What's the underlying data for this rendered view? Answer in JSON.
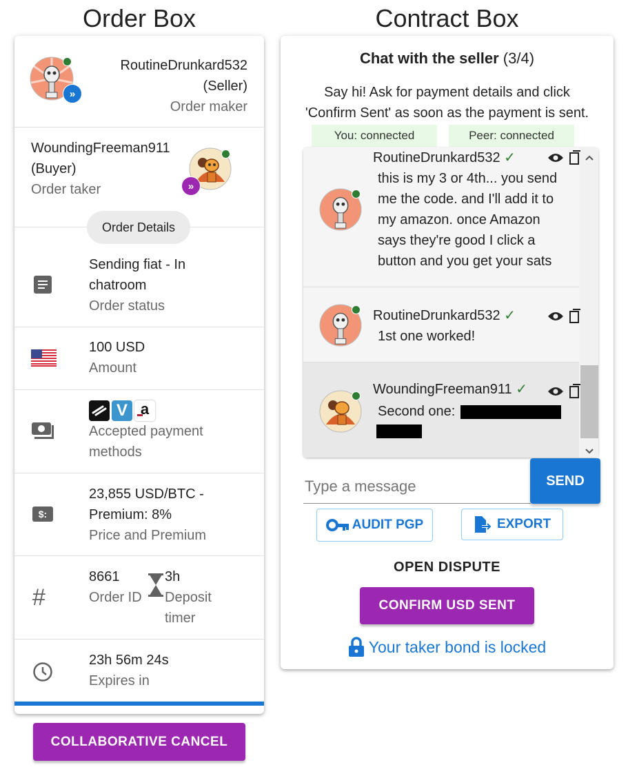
{
  "titles": {
    "order_box": "Order Box",
    "contract_box": "Contract Box"
  },
  "colors": {
    "purple": "#9c27b0",
    "blue": "#1976d2",
    "online": "#2e7d32",
    "chip_bg": "#e8f9e6"
  },
  "order": {
    "maker": {
      "name": "RoutineDrunkard532",
      "role": "(Seller)",
      "caption": "Order maker",
      "icon": "robot-avatar"
    },
    "taker": {
      "name": "WoundingFreeman911",
      "role": "(Buyer)",
      "caption": "Order taker",
      "icon": "robot-avatar"
    },
    "details_chip": "Order Details",
    "status": {
      "line1": "Sending fiat - In",
      "line2": "chatroom",
      "caption": "Order status",
      "icon": "article-icon"
    },
    "amount": {
      "value": "100 USD",
      "caption": "Amount",
      "icon": "us-flag-icon"
    },
    "payment": {
      "caption_line1": "Accepted payment",
      "caption_line2": "methods",
      "icons": [
        "strike-icon",
        "venmo-icon",
        "amazon-icon"
      ],
      "venmo_letter": "V",
      "amazon_letter": "a"
    },
    "price": {
      "line1": "23,855 USD/BTC -",
      "line2": "Premium: 8%",
      "caption": "Price and Premium",
      "icon": "price-icon",
      "icon_text": "$:"
    },
    "order_id": {
      "value": "8661",
      "caption": "Order ID",
      "icon": "hash-icon",
      "icon_text": "#"
    },
    "deposit": {
      "value": "3h",
      "caption_line1": "Deposit",
      "caption_line2": "timer",
      "icon": "hourglass-icon"
    },
    "expires": {
      "value": "23h 56m 24s",
      "caption": "Expires in",
      "icon": "clock-icon"
    },
    "collab_cancel": "COLLABORATIVE CANCEL"
  },
  "contract": {
    "chat_title": "Chat with the seller",
    "chat_count": "(3/4)",
    "intro_line1": "Say hi! Ask for payment details and click",
    "intro_line2": "'Confirm Sent' as soon as the payment is sent.",
    "you_status": "You: connected",
    "peer_status": "Peer: connected",
    "messages": [
      {
        "author": "RoutineDrunkard532",
        "lines": [
          "this is my 3 or 4th... you send",
          "me the code. and I'll add it to",
          "my amazon. once Amazon",
          "says they're good I click a",
          "button and you get your sats"
        ]
      },
      {
        "author": "RoutineDrunkard532",
        "lines": [
          "1st one worked!"
        ]
      },
      {
        "author": "WoundingFreeman911",
        "lines": [
          "Second one:"
        ]
      }
    ],
    "check_mark": "✓",
    "input_placeholder": "Type a message",
    "send": "SEND",
    "audit_pgp": "AUDIT PGP",
    "export": "EXPORT",
    "open_dispute": "OPEN DISPUTE",
    "confirm_sent": "CONFIRM USD SENT",
    "bond_locked": "Your taker bond is locked"
  }
}
